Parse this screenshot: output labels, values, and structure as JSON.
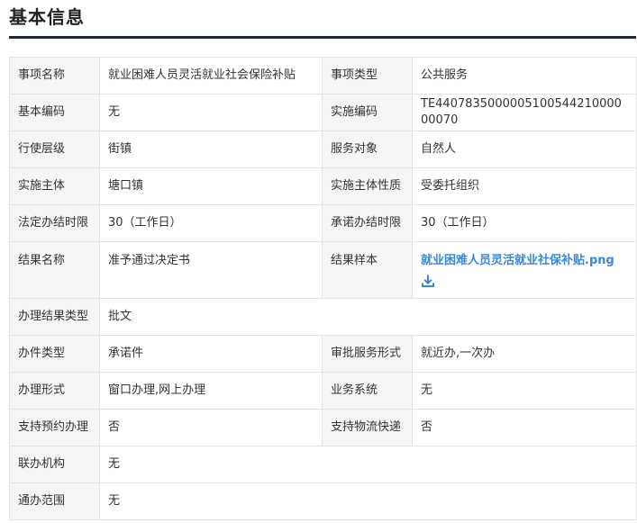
{
  "section": {
    "title": "基本信息"
  },
  "rows": [
    {
      "l1": "事项名称",
      "v1": "就业困难人员灵活就业社会保险补贴",
      "l2": "事项类型",
      "v2": "公共服务"
    },
    {
      "l1": "基本编码",
      "v1": "无",
      "l2": "实施编码",
      "v2": "TE440783500000510054421000000070"
    },
    {
      "l1": "行使层级",
      "v1": "街镇",
      "l2": "服务对象",
      "v2": "自然人"
    },
    {
      "l1": "实施主体",
      "v1": "塘口镇",
      "l2": "实施主体性质",
      "v2": "受委托组织"
    },
    {
      "l1": "法定办结时限",
      "v1": "30（工作日）",
      "l2": "承诺办结时限",
      "v2": "30（工作日）"
    },
    {
      "l1": "结果名称",
      "v1": "准予通过决定书",
      "l2": "结果样本",
      "file": "就业困难人员灵活就业社保补贴.png",
      "file_icon": "download-icon"
    },
    {
      "l1": "办理结果类型",
      "v1": "批文"
    },
    {
      "l1": "办件类型",
      "v1": "承诺件",
      "l2": "审批服务形式",
      "v2": "就近办,一次办"
    },
    {
      "l1": "办理形式",
      "v1": "窗口办理,网上办理",
      "l2": "业务系统",
      "v2": "无"
    },
    {
      "l1": "支持预约办理",
      "v1": "否",
      "l2": "支持物流快递",
      "v2": "否"
    },
    {
      "l1": "联办机构",
      "v1": "无"
    },
    {
      "l1": "通办范围",
      "v1": "无"
    }
  ],
  "colors": {
    "title_rule": "#1f2a36",
    "label_bg": "#f5f5f5",
    "border": "#e3e3e3",
    "link": "#3a87d6"
  }
}
